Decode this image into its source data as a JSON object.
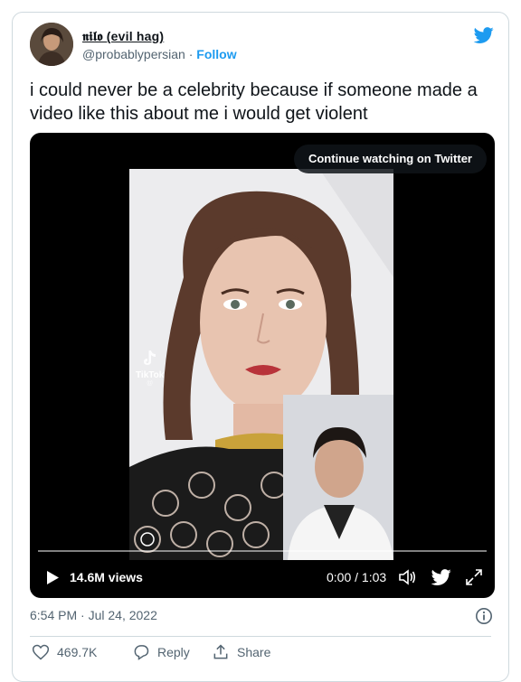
{
  "author": {
    "name": "𝖓𝖎𝖑𝖔 (evil hag)",
    "handle": "@probablypersian",
    "separator": "·",
    "follow_label": "Follow"
  },
  "tweet": {
    "text": "i could never be a celebrity because if someone made a video like this about me i would get violent"
  },
  "video": {
    "continue_label": "Continue watching on Twitter",
    "watermark_brand": "TikTok",
    "watermark_handle": "@",
    "views": "14.6M views",
    "time": "0:00 / 1:03",
    "progress": 0.0
  },
  "meta": {
    "timestamp": "6:54 PM · Jul 24, 2022"
  },
  "actions": {
    "likes": "469.7K",
    "reply_label": "Reply",
    "share_label": "Share"
  },
  "icons": [
    "twitter-bird-icon",
    "play-icon",
    "volume-icon",
    "fullscreen-icon",
    "info-icon",
    "heart-icon",
    "reply-icon",
    "share-icon"
  ],
  "colors": {
    "accent": "#1d9bf0",
    "muted": "#536471",
    "text": "#0f1419",
    "border": "#cfd9de"
  }
}
